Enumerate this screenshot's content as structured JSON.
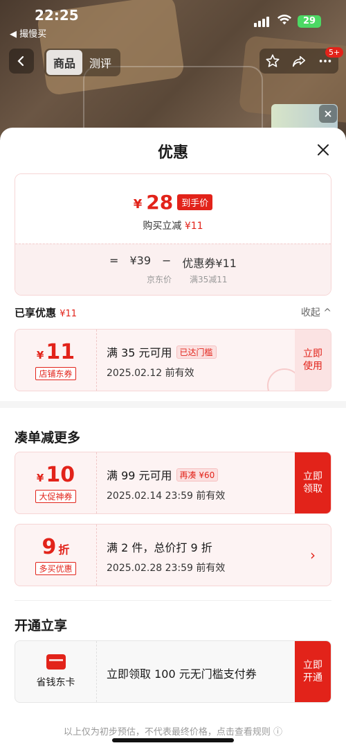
{
  "status": {
    "time": "22:25",
    "back_app": "◀ 撮慢买",
    "battery": "29"
  },
  "nav": {
    "tabs": [
      {
        "label": "商品"
      },
      {
        "label": "测评"
      }
    ],
    "badge": "5+"
  },
  "sheet": {
    "title": "优惠",
    "price_card": {
      "yen": "¥",
      "final_price": "28",
      "final_tag": "到手价",
      "sub_text": "购买立减",
      "sub_amount": "¥11",
      "formula": {
        "equals": "=",
        "original": "¥39",
        "minus": "−",
        "discount": "优惠券¥11"
      },
      "labels": {
        "original_label": "京东价",
        "discount_label": "满35减11"
      }
    },
    "enjoyed": {
      "label": "已享优惠",
      "amount": "¥11",
      "collapse": "收起 ^"
    },
    "enjoyed_coupon": {
      "yen": "¥",
      "amount": "11",
      "tag": "店铺东券",
      "condition": "满 35 元可用",
      "pill": "已达门槛",
      "expiry": "2025.02.12 前有效",
      "action": "立即使用"
    },
    "more_section": {
      "title": "凑单减更多"
    },
    "more_coupons": [
      {
        "yen": "¥",
        "amount": "10",
        "tag": "大促神券",
        "condition": "满 99 元可用",
        "pill": "再凑 ¥60",
        "expiry": "2025.02.14 23:59 前有效",
        "action": "立即领取"
      },
      {
        "amount": "9",
        "unit": "折",
        "tag": "多买优惠",
        "condition": "满 2 件，总价打 9 折",
        "expiry": "2025.02.28 23:59 前有效",
        "action": "›"
      }
    ],
    "open_section": {
      "title": "开通立享"
    },
    "card_offer": {
      "card_label": "省钱东卡",
      "text": "立即领取 100 元无门槛支付券",
      "action": "立即开通"
    },
    "footer": "以上仅为初步预估，不代表最终价格，点击查看规则 ⓘ"
  },
  "colors": {
    "accent": "#e2231a",
    "soft": "#fdf3f3"
  }
}
